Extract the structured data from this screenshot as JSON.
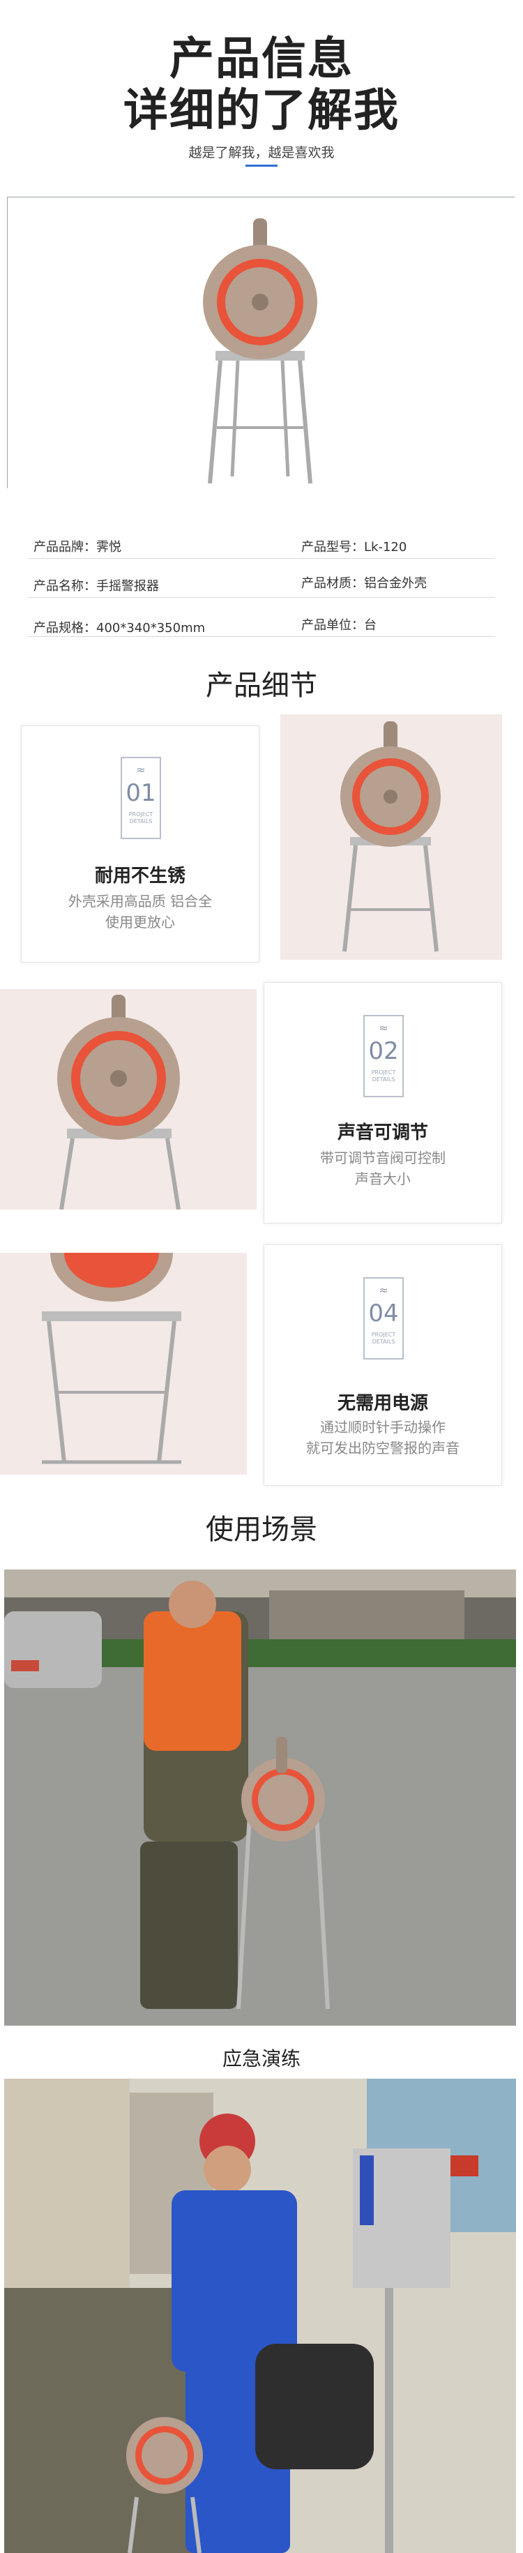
{
  "header": {
    "title_line1": "产品信息",
    "title_line2": "详细的了解我",
    "subtitle": "越是了解我，越是喜欢我"
  },
  "specs": {
    "brand": "产品品牌：霁悦",
    "model": "产品型号：Lk-120",
    "name": "产品名称：手摇警报器",
    "material": "产品材质：铝合金外壳",
    "size": "产品规格：400*340*350mm",
    "unit": "产品单位：台"
  },
  "sections": {
    "details": "产品细节",
    "usage": "使用场景"
  },
  "features": [
    {
      "num": "01",
      "badge_text": "PROJECT DETAILS",
      "title": "耐用不生锈",
      "desc1": "外壳采用高品质 铝合全",
      "desc2": "使用更放心"
    },
    {
      "num": "02",
      "badge_text": "PROJECT DETAILS",
      "title": "声音可调节",
      "desc1": "带可调节音阀可控制",
      "desc2": "声音大小"
    },
    {
      "num": "04",
      "badge_text": "PROJECT DETAILS",
      "title": "无需用电源",
      "desc1": "通过顺时针手动操作",
      "desc2": "就可发出防空警报的声音"
    }
  ],
  "scenes": {
    "caption1": "应急演练"
  },
  "colors": {
    "accent": "#2f6fd6",
    "siren_body": "#b7a08f",
    "siren_red": "#e8533a",
    "stand": "#a8a8a8"
  }
}
